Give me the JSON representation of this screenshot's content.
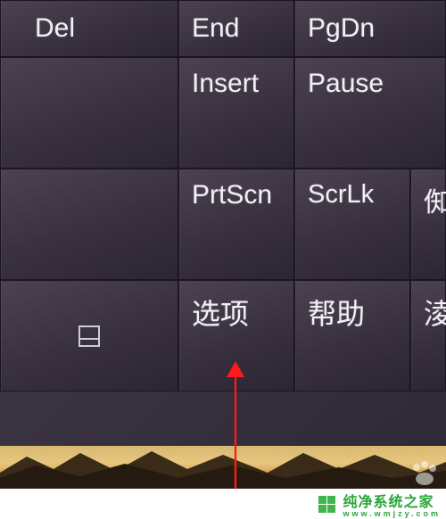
{
  "keyboard": {
    "row0": {
      "del": "Del",
      "end": "End",
      "pgdn": "PgDn"
    },
    "row1": {
      "insert": "Insert",
      "pause": "Pause"
    },
    "row2": {
      "prtscn": "PrtScn",
      "scrlk": "ScrLk",
      "partial1": "倁"
    },
    "row3": {
      "options": "选项",
      "help": "帮助",
      "partial2": "淩"
    }
  },
  "annotation": {
    "arrow_target": "options-key"
  },
  "watermark": {
    "brand": "纯净系统之家",
    "url": "www.wmjzy.com"
  },
  "colors": {
    "key_bg": "#3a3140",
    "key_fg": "#f0f0f5",
    "arrow": "#ff1a1a",
    "brand": "#2aa53a"
  }
}
